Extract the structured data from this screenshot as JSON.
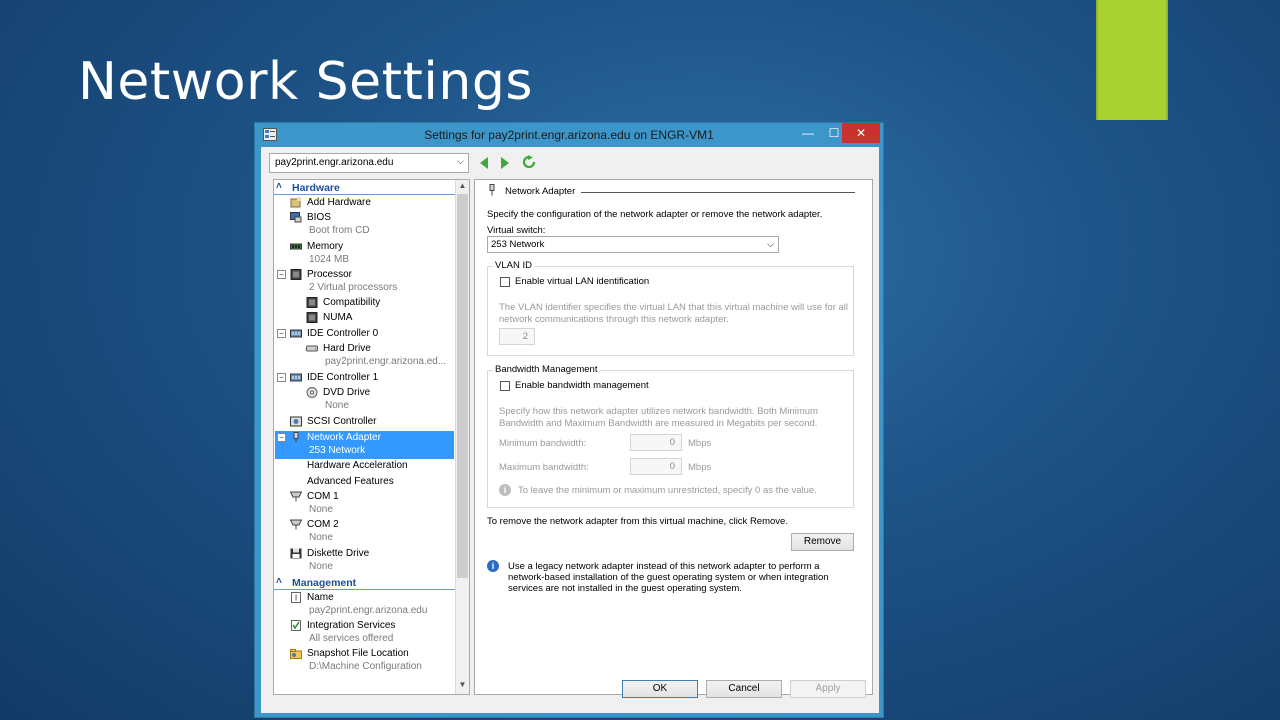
{
  "slide": {
    "title": "Network Settings"
  },
  "window": {
    "title": "Settings for pay2print.engr.arizona.edu on ENGR-VM1",
    "minimize": "—",
    "maximize": "☐",
    "close": "✕"
  },
  "toolbar": {
    "vm_selector": "pay2print.engr.arizona.edu"
  },
  "tree": {
    "hardware_header": "Hardware",
    "management_header": "Management",
    "items": [
      {
        "label": "Add Hardware",
        "sub": ""
      },
      {
        "label": "BIOS",
        "sub": "Boot from CD"
      },
      {
        "label": "Memory",
        "sub": "1024 MB"
      },
      {
        "label": "Processor",
        "sub": "2 Virtual processors"
      },
      {
        "label": "Compatibility",
        "sub": ""
      },
      {
        "label": "NUMA",
        "sub": ""
      },
      {
        "label": "IDE Controller 0",
        "sub": ""
      },
      {
        "label": "Hard Drive",
        "sub": "pay2print.engr.arizona.ed..."
      },
      {
        "label": "IDE Controller 1",
        "sub": ""
      },
      {
        "label": "DVD Drive",
        "sub": "None"
      },
      {
        "label": "SCSI Controller",
        "sub": ""
      },
      {
        "label": "Network Adapter",
        "sub": "253 Network"
      },
      {
        "label": "Hardware Acceleration",
        "sub": ""
      },
      {
        "label": "Advanced Features",
        "sub": ""
      },
      {
        "label": "COM 1",
        "sub": "None"
      },
      {
        "label": "COM 2",
        "sub": "None"
      },
      {
        "label": "Diskette Drive",
        "sub": "None"
      },
      {
        "label": "Name",
        "sub": "pay2print.engr.arizona.edu"
      },
      {
        "label": "Integration Services",
        "sub": "All services offered"
      },
      {
        "label": "Snapshot File Location",
        "sub": "D:\\Machine Configuration"
      }
    ]
  },
  "panel": {
    "heading": "Network Adapter",
    "intro": "Specify the configuration of the network adapter or remove the network adapter.",
    "virtual_switch_label": "Virtual switch:",
    "virtual_switch_value": "253 Network",
    "vlan": {
      "title": "VLAN ID",
      "checkbox_label": "Enable virtual LAN identification",
      "desc1": "The VLAN identifier specifies the virtual LAN that this virtual machine will use for all",
      "desc2": "network communications through this network adapter.",
      "value": "2"
    },
    "bandwidth": {
      "title": "Bandwidth Management",
      "checkbox_label": "Enable bandwidth management",
      "desc1": "Specify how this network adapter utilizes network bandwidth. Both Minimum",
      "desc2": "Bandwidth and Maximum Bandwidth are measured in Megabits per second.",
      "min_label": "Minimum bandwidth:",
      "min_value": "0",
      "max_label": "Maximum bandwidth:",
      "max_value": "0",
      "unit": "Mbps",
      "note": "To leave the minimum or maximum unrestricted, specify 0 as the value."
    },
    "remove_text": "To remove the network adapter from this virtual machine, click Remove.",
    "remove_button": "Remove",
    "legacy1": "Use a legacy network adapter instead of this network adapter to perform a",
    "legacy2": "network-based installation of the guest operating system or when integration",
    "legacy3": "services are not installed in the guest operating system."
  },
  "buttons": {
    "ok": "OK",
    "cancel": "Cancel",
    "apply": "Apply"
  },
  "colors": {
    "accent": "#a8d232",
    "selection": "#3399ff",
    "close": "#c9322f",
    "titlebar": "#3d96c9"
  }
}
